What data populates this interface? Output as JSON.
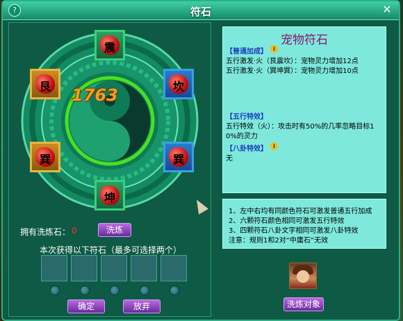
{
  "window": {
    "title": "符石",
    "help_label": "?",
    "close_label": "✕"
  },
  "wheel": {
    "tiles": {
      "top": "震",
      "upper_left": "艮",
      "upper_right": "坎",
      "lower_left": "巽",
      "lower_right": "巽",
      "bottom": "坤"
    },
    "score": "1763"
  },
  "stones": {
    "label": "拥有洗炼石：",
    "count": "0",
    "wash_button": "洗炼"
  },
  "choose": {
    "label": "本次获得以下符石（最多可选择两个）",
    "slot_count": 5
  },
  "buttons": {
    "confirm": "确定",
    "abandon": "放弃",
    "target": "洗炼对象"
  },
  "info": {
    "title": "宠物符石",
    "section1": "【普通加成】",
    "line1": "五行激发·火（艮震坎）：宠物灵力增加12点",
    "line2": "五行激发·火（巽坤巽）：宠物灵力增加10点",
    "section2": "【五行特效】",
    "line3": "五行特效（火）：攻击时有50%的几率忽略目标1",
    "line4": "0%的灵力",
    "section3": "【八卦特效】",
    "line5": "无"
  },
  "rules": {
    "r1": "1、左中右均有同颜色符石可激发普通五行加成",
    "r2": "2、六颗符石颜色相同可激发五行特效",
    "r3": "3、四颗符石八卦文字相同可激发八卦特效",
    "r4": "注意：规则1和2对“中庸石”无效"
  },
  "colors": {
    "panel": "#0e5a44",
    "info_bg": "#7ee8dc",
    "accent": "#2fae86",
    "title_purple": "#8a1a6a",
    "tile_blue": "#2a7ad0",
    "tile_gold": "#d08a20",
    "tile_green": "#28a060"
  }
}
